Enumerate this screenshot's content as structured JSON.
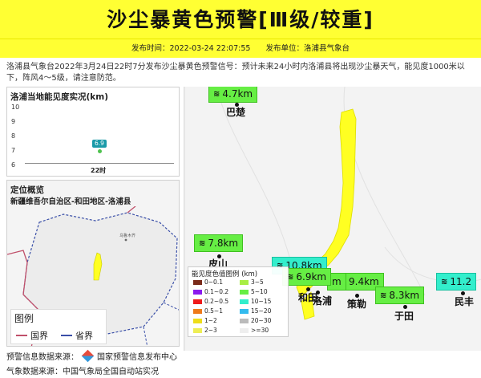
{
  "header": {
    "title": "沙尘暴黄色预警[Ⅲ级/较重]",
    "publish_time": "发布时间：2022-03-24 22:07:55",
    "publisher": "发布单位：洛浦县气象台"
  },
  "description": "洛浦县气象台2022年3月24日22时7分发布沙尘暴黄色预警信号：预计未来24小时内洛浦县将出现沙尘暴天气，能见度1000米以下，阵风4～5级，请注意防范。",
  "visibility_panel": {
    "title": "洛浦当地能见度实况(km)",
    "chart_data": {
      "type": "scatter",
      "title": "洛浦当地能见度实况(km)",
      "categories": [
        "22时"
      ],
      "values": [
        6.9
      ],
      "yticks": [
        "10",
        "9",
        "8",
        "7",
        "6"
      ],
      "ylim": [
        6,
        10
      ],
      "data_label": "6.9"
    }
  },
  "location_panel": {
    "title": "定位概览",
    "region": "新疆维吾尔自治区-和田地区-洛浦县",
    "small_label": "乌鲁木齐",
    "legend_title": "图例",
    "legend_items": [
      {
        "label": "国界",
        "color": "#c0506a"
      },
      {
        "label": "省界",
        "color": "#3a4fa8"
      }
    ]
  },
  "main_map": {
    "badges": [
      {
        "text": "4.7km",
        "wind": "≋",
        "style": "green"
      },
      {
        "text": "7.8km",
        "wind": "≋",
        "style": "green"
      },
      {
        "text": "10.8km",
        "wind": "≋",
        "style": "teal"
      },
      {
        "text": "6.9km",
        "wind": "≋",
        "style": "green"
      },
      {
        "text": "m",
        "wind": "",
        "style": "green"
      },
      {
        "text": "9.4km",
        "wind": "",
        "style": "green"
      },
      {
        "text": "8.3km",
        "wind": "≋",
        "style": "green"
      },
      {
        "text": "11.2",
        "wind": "≋",
        "style": "teal"
      }
    ],
    "cities": [
      "巴楚",
      "皮山",
      "和田",
      "洛浦",
      "策勒",
      "于田",
      "民丰"
    ],
    "legend": {
      "title": "能见度色值图例 (km)",
      "items": [
        {
          "label": "0~0.1",
          "color": "#7a2a1a"
        },
        {
          "label": "3~5",
          "color": "#a8ee44"
        },
        {
          "label": "0.1~0.2",
          "color": "#8a1aee"
        },
        {
          "label": "5~10",
          "color": "#66ee44"
        },
        {
          "label": "0.2~0.5",
          "color": "#ee1a1a"
        },
        {
          "label": "10~15",
          "color": "#33eecc"
        },
        {
          "label": "0.5~1",
          "color": "#ee7a1a"
        },
        {
          "label": "15~20",
          "color": "#33bbee"
        },
        {
          "label": "1~2",
          "color": "#eedd1a"
        },
        {
          "label": "20~30",
          "color": "#bbbbbb"
        },
        {
          "label": "2~3",
          "color": "#eeee55"
        },
        {
          "label": ">=30",
          "color": "#eeeeee"
        }
      ]
    }
  },
  "footer": {
    "source1_prefix": "预警信息数据来源：",
    "source1_name": "国家预警信息发布中心",
    "source2": "气象数据来源：中国气象局全国自动站实况"
  },
  "colors": {
    "banner": "#ffff33",
    "warning_area": "#ffff22"
  }
}
